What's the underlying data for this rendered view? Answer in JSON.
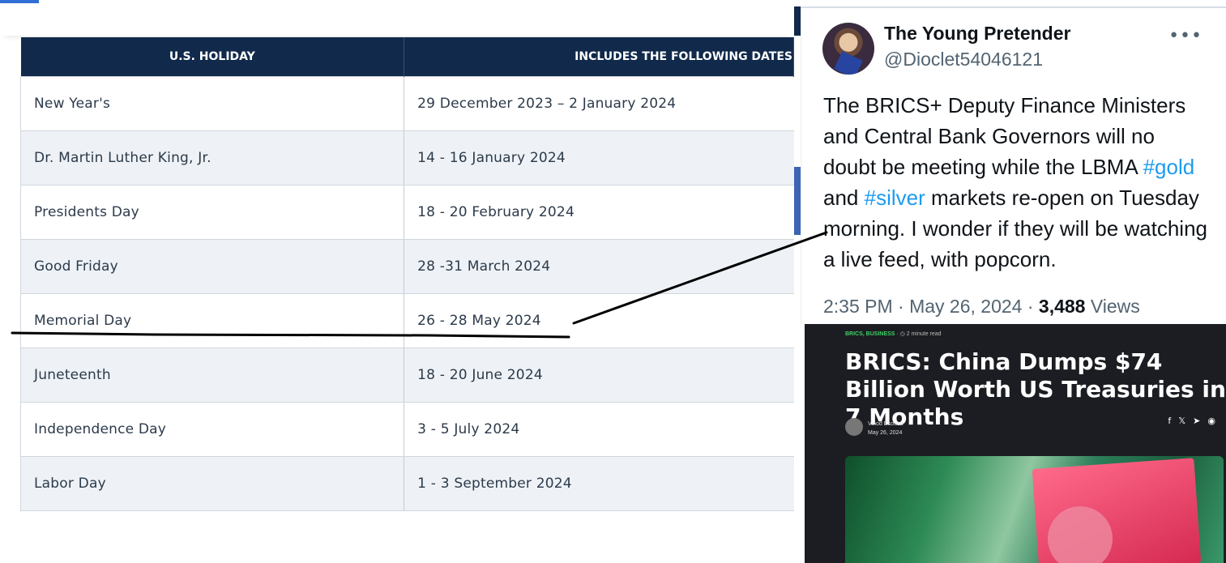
{
  "table": {
    "headers": [
      "U.S. HOLIDAY",
      "INCLUDES THE FOLLOWING DATES"
    ],
    "rows": [
      {
        "holiday": "New Year's",
        "dates": "29 December 2023 – 2 January 2024"
      },
      {
        "holiday": "Dr. Martin Luther King, Jr.",
        "dates": "14 - 16 January 2024"
      },
      {
        "holiday": "Presidents Day",
        "dates": "18 - 20 February 2024"
      },
      {
        "holiday": "Good Friday",
        "dates": "28 -31 March 2024"
      },
      {
        "holiday": "Memorial Day",
        "dates": "26 - 28 May 2024"
      },
      {
        "holiday": "Juneteenth",
        "dates": "18 - 20 June 2024"
      },
      {
        "holiday": "Independence Day",
        "dates": "3 - 5 July 2024"
      },
      {
        "holiday": "Labor Day",
        "dates": "1 - 3 September 2024"
      }
    ]
  },
  "tweet": {
    "name": "The Young Pretender",
    "handle": "@Dioclet54046121",
    "more_icon": "more-horizontal-icon",
    "text_1": "The BRICS+ Deputy Finance Ministers and Central Bank Governors will no doubt be meeting while the LBMA ",
    "tag_1": "#gold",
    "text_2": " and ",
    "tag_2": "#silver",
    "text_3": " markets re-open on Tuesday morning. I wonder if they will be watching a live feed, with popcorn.",
    "time": "2:35 PM · May 26, 2024 · ",
    "views_count": "3,488",
    "views_label": " Views"
  },
  "news": {
    "category": "BRICS, BUSINESS",
    "read_time": "2 minute read",
    "title": "BRICS: China Dumps $74 Billion Worth US Treasuries in 7 Months",
    "author": "Vinod Dsouza",
    "date": "May 26, 2024",
    "share_icons": [
      "facebook-icon",
      "x-icon",
      "telegram-icon",
      "reddit-icon"
    ]
  },
  "colors": {
    "table_header": "#112a4b",
    "hashtag": "#1d9bf0",
    "news_category": "#3ecf63"
  }
}
